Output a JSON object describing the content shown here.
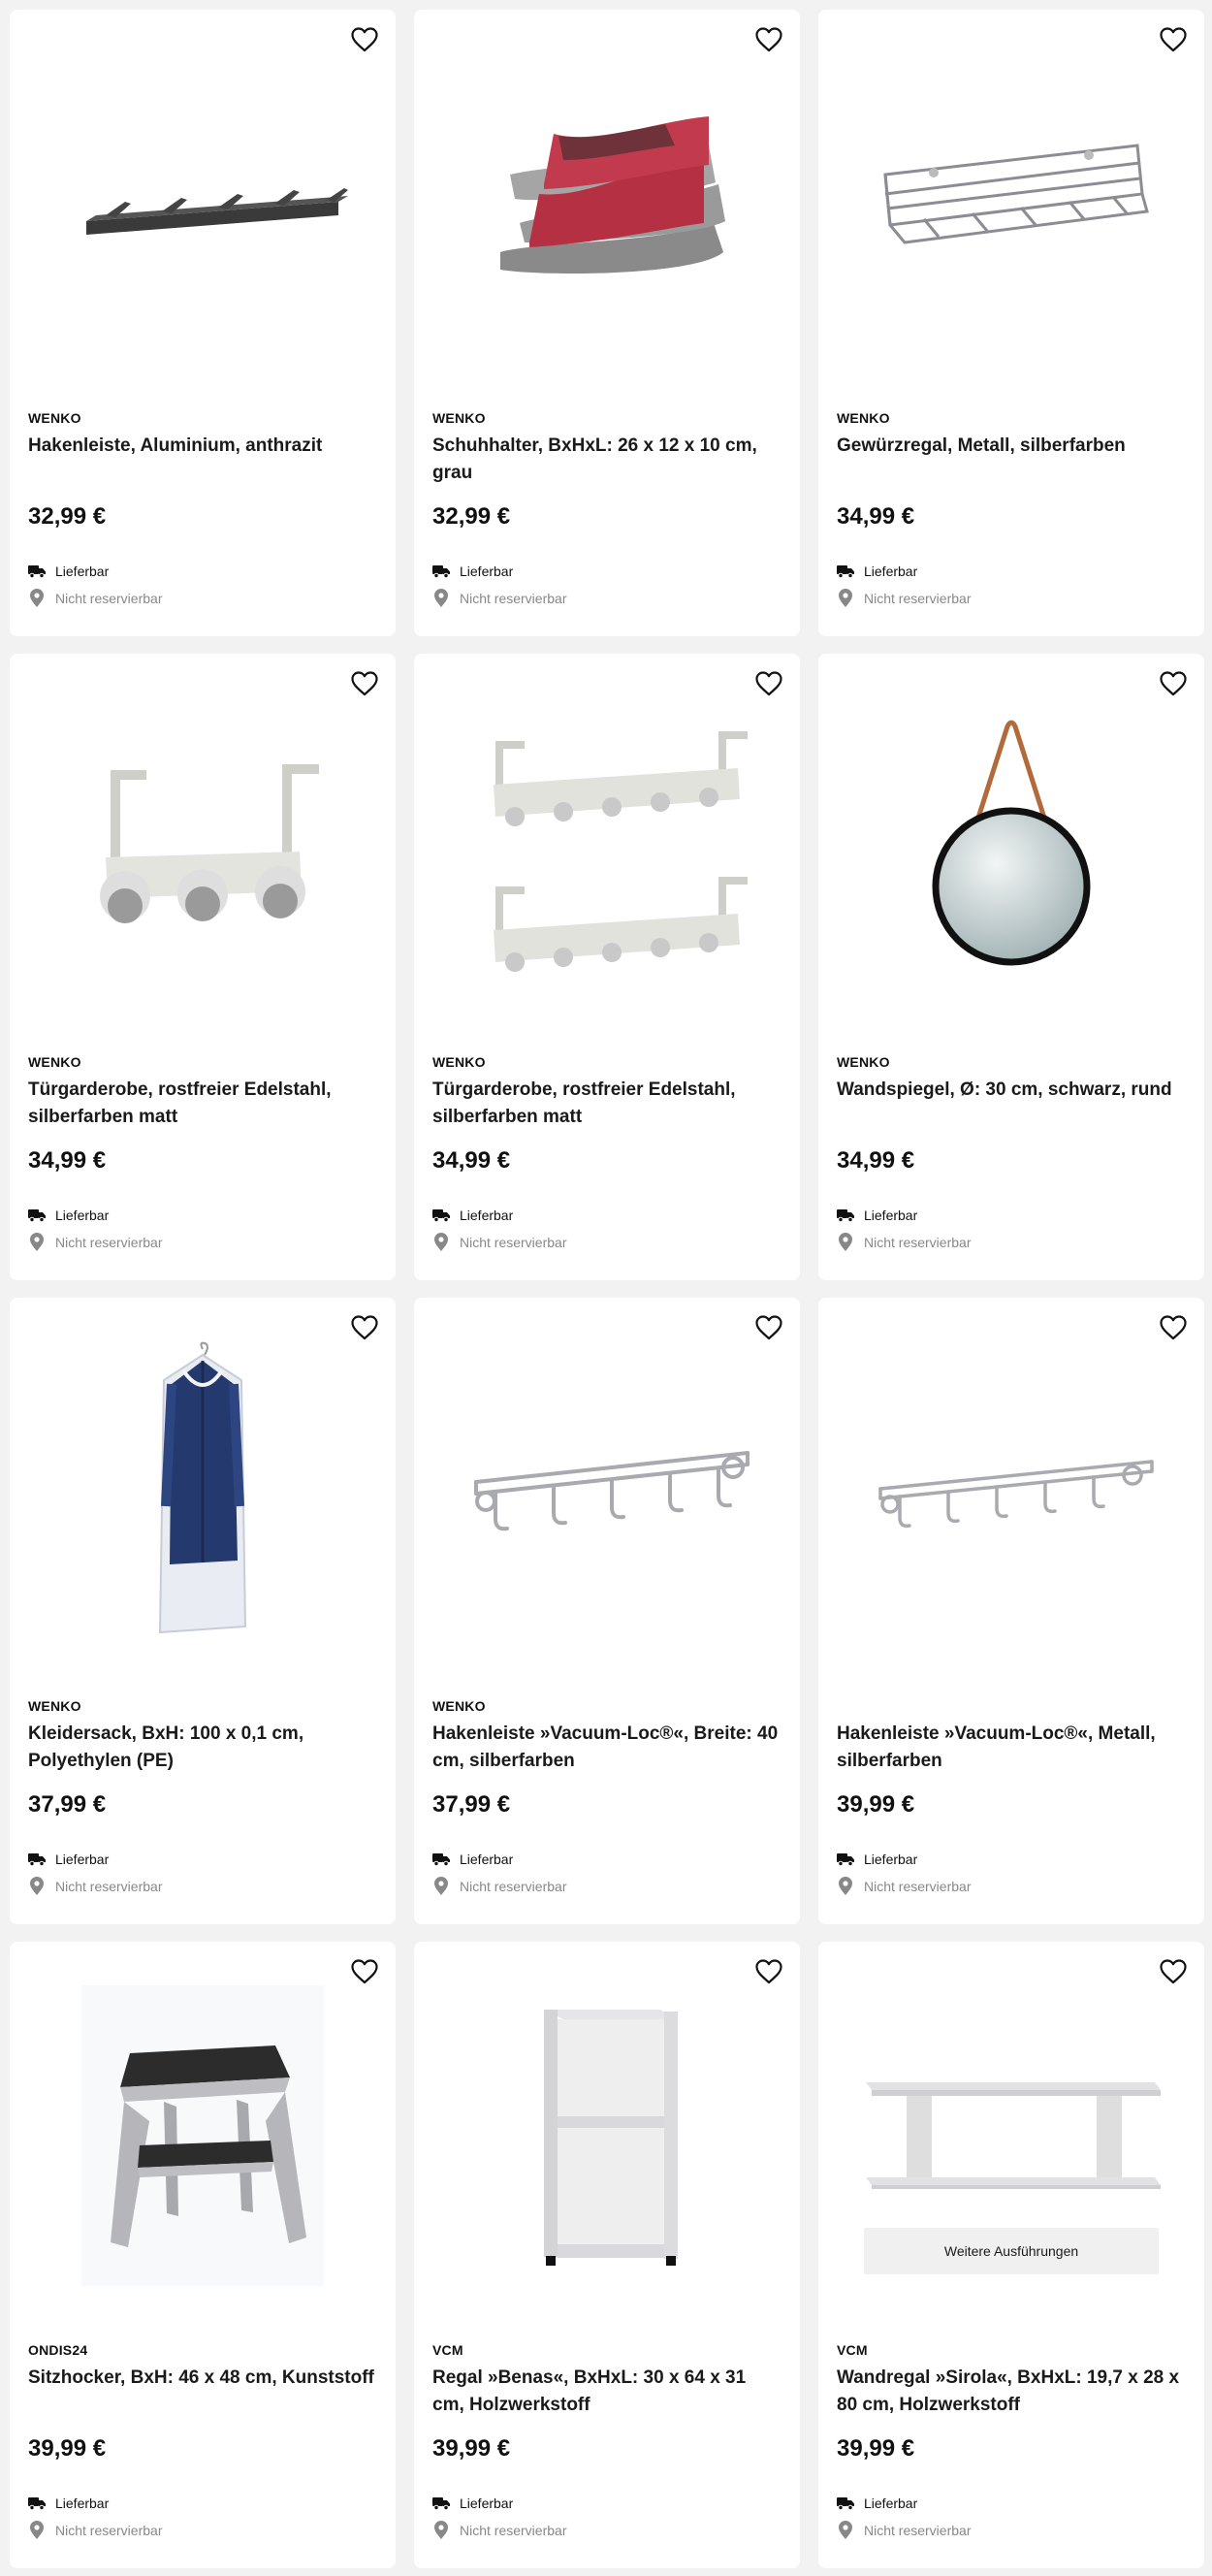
{
  "products": [
    {
      "brand": "WENKO",
      "title": "Hakenleiste, Aluminium, anthrazit",
      "price": "32,99 €",
      "delivery": "Lieferbar",
      "reserve": "Nicht reservierbar",
      "image": "hook-rail-anthracite"
    },
    {
      "brand": "WENKO",
      "title": "Schuhhalter, BxHxL: 26 x 12 x 10 cm, grau",
      "price": "32,99 €",
      "delivery": "Lieferbar",
      "reserve": "Nicht reservierbar",
      "image": "shoe-holder"
    },
    {
      "brand": "WENKO",
      "title": "Gewürzregal, Metall, silberfarben",
      "price": "34,99 €",
      "delivery": "Lieferbar",
      "reserve": "Nicht reservierbar",
      "image": "spice-rack"
    },
    {
      "brand": "WENKO",
      "title": "Türgarderobe, rostfreier Edelstahl, silberfarben matt",
      "price": "34,99 €",
      "delivery": "Lieferbar",
      "reserve": "Nicht reservierbar",
      "image": "door-hook-3"
    },
    {
      "brand": "WENKO",
      "title": "Türgarderobe, rostfreier Edelstahl, silberfarben matt",
      "price": "34,99 €",
      "delivery": "Lieferbar",
      "reserve": "Nicht reservierbar",
      "image": "door-hook-6-double"
    },
    {
      "brand": "WENKO",
      "title": "Wandspiegel, Ø: 30 cm, schwarz, rund",
      "price": "34,99 €",
      "delivery": "Lieferbar",
      "reserve": "Nicht reservierbar",
      "image": "round-mirror"
    },
    {
      "brand": "WENKO",
      "title": "Kleidersack, BxH: 100 x 0,1 cm, Polyethylen (PE)",
      "price": "37,99 €",
      "delivery": "Lieferbar",
      "reserve": "Nicht reservierbar",
      "image": "garment-bag"
    },
    {
      "brand": "WENKO",
      "title": "Hakenleiste »Vacuum-Loc®«, Breite: 40 cm, silberfarben",
      "price": "37,99 €",
      "delivery": "Lieferbar",
      "reserve": "Nicht reservierbar",
      "image": "chrome-hook-rail"
    },
    {
      "brand": "",
      "title": "Hakenleiste »Vacuum-Loc®«, Metall, silberfarben",
      "price": "39,99 €",
      "delivery": "Lieferbar",
      "reserve": "Nicht reservierbar",
      "image": "chrome-hook-rail-long"
    },
    {
      "brand": "ONDIS24",
      "title": "Sitzhocker, BxH: 46 x 48 cm, Kunststoff",
      "price": "39,99 €",
      "delivery": "Lieferbar",
      "reserve": "Nicht reservierbar",
      "image": "step-stool"
    },
    {
      "brand": "VCM",
      "title": "Regal »Benas«, BxHxL: 30 x 64 x 31 cm, Holzwerkstoff",
      "price": "39,99 €",
      "delivery": "Lieferbar",
      "reserve": "Nicht reservierbar",
      "image": "shelf-benas"
    },
    {
      "brand": "VCM",
      "title": "Wandregal »Sirola«, BxHxL: 19,7 x 28 x 80 cm, Holzwerkstoff",
      "price": "39,99 €",
      "delivery": "Lieferbar",
      "reserve": "Nicht reservierbar",
      "image": "wall-shelf-sirola",
      "variants_label": "Weitere Ausführungen"
    }
  ],
  "icons": {
    "wishlist": "heart-outline-icon",
    "delivery": "truck-icon",
    "store": "map-pin-icon"
  },
  "colors": {
    "background": "#f2f2f2",
    "card": "#ffffff",
    "text": "#1a1a1a",
    "muted": "#888888"
  }
}
